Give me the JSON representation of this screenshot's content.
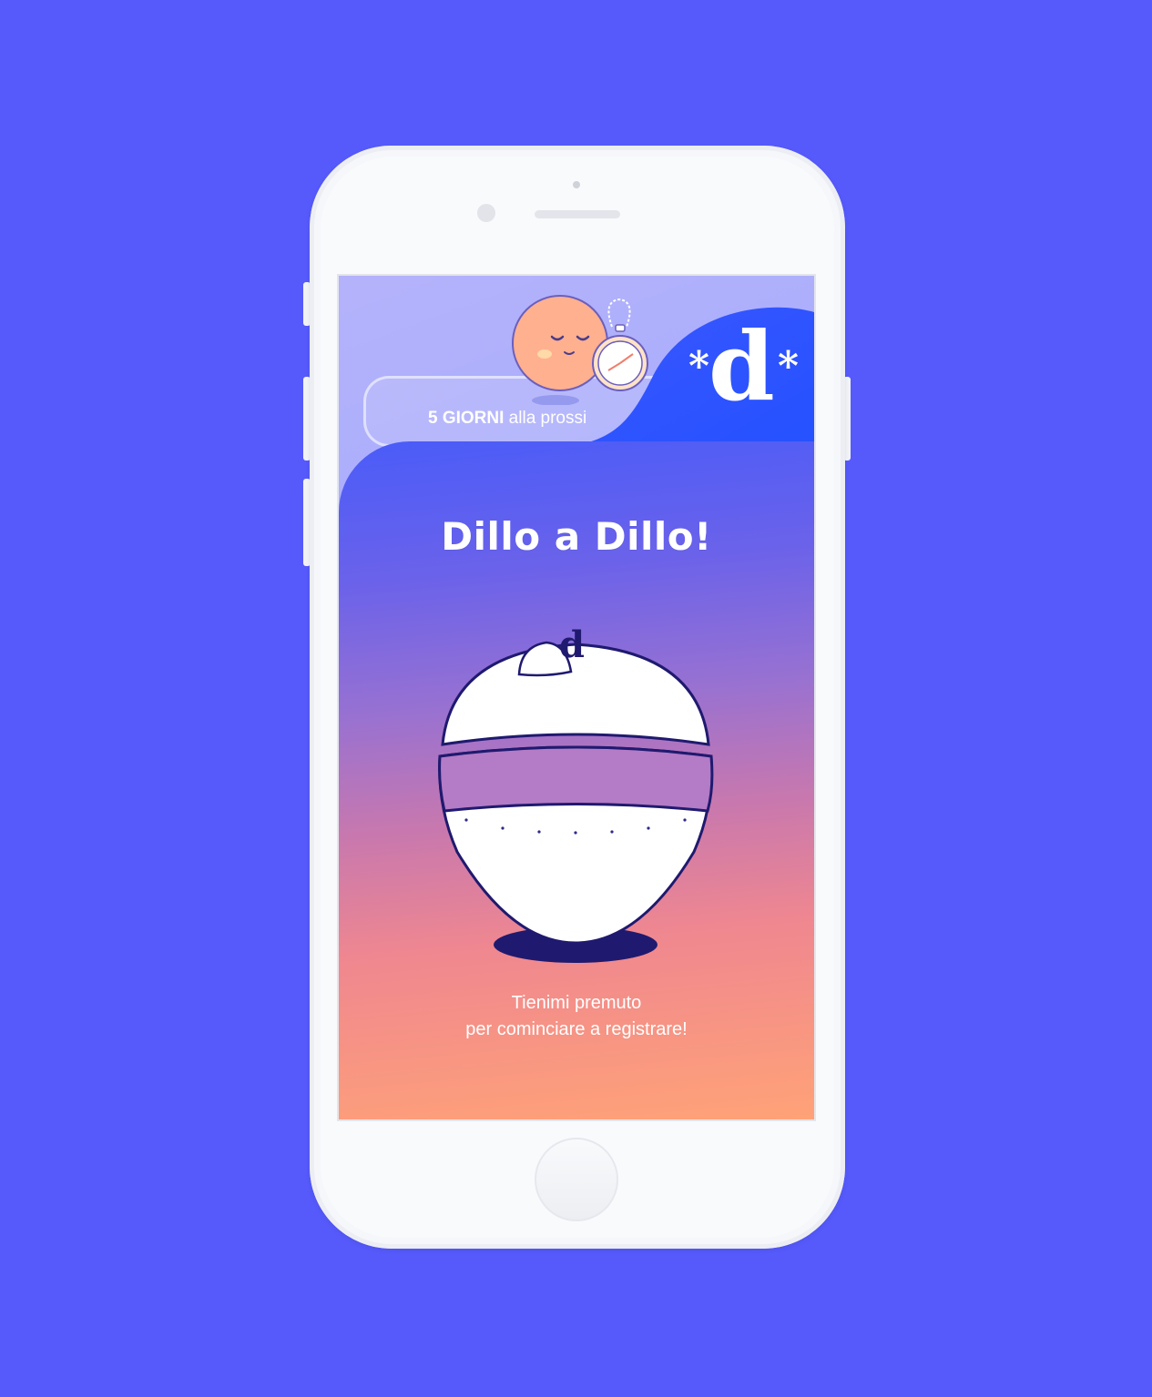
{
  "app": {
    "logo_letter": "d",
    "logo_star": "*",
    "countdown": {
      "bold": "5 GIORNI",
      "rest": " alla prossi"
    },
    "title": "Dillo a Dillo!",
    "record_button_letter": "d",
    "hint_line1": "Tienimi premuto",
    "hint_line2": "per cominciare a registrare!"
  },
  "colors": {
    "background": "#565afb",
    "accent_blue": "#2f5bff",
    "ball_outline": "#1f1a6f",
    "mascot_face": "#ffb08f"
  },
  "icons": [
    "mascot-sleeping-face",
    "stopwatch-icon",
    "record-ball-icon"
  ]
}
